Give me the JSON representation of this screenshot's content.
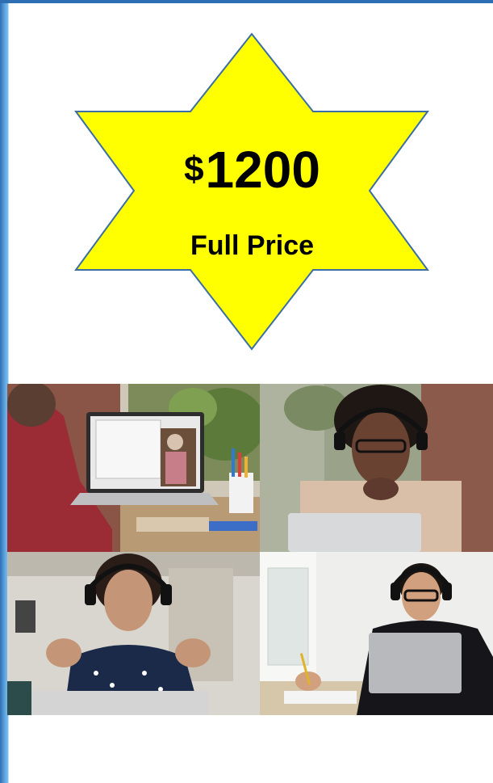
{
  "badge": {
    "currency": "$",
    "amount": "1200",
    "label": "Full Price",
    "fill_color": "#ffff00",
    "stroke_color": "#3a6ea5"
  },
  "photos": [
    {
      "subject": "laptop-video-lesson-photo"
    },
    {
      "subject": "student-with-headphones-photo"
    },
    {
      "subject": "student-gesturing-photo"
    },
    {
      "subject": "student-writing-photo"
    }
  ]
}
